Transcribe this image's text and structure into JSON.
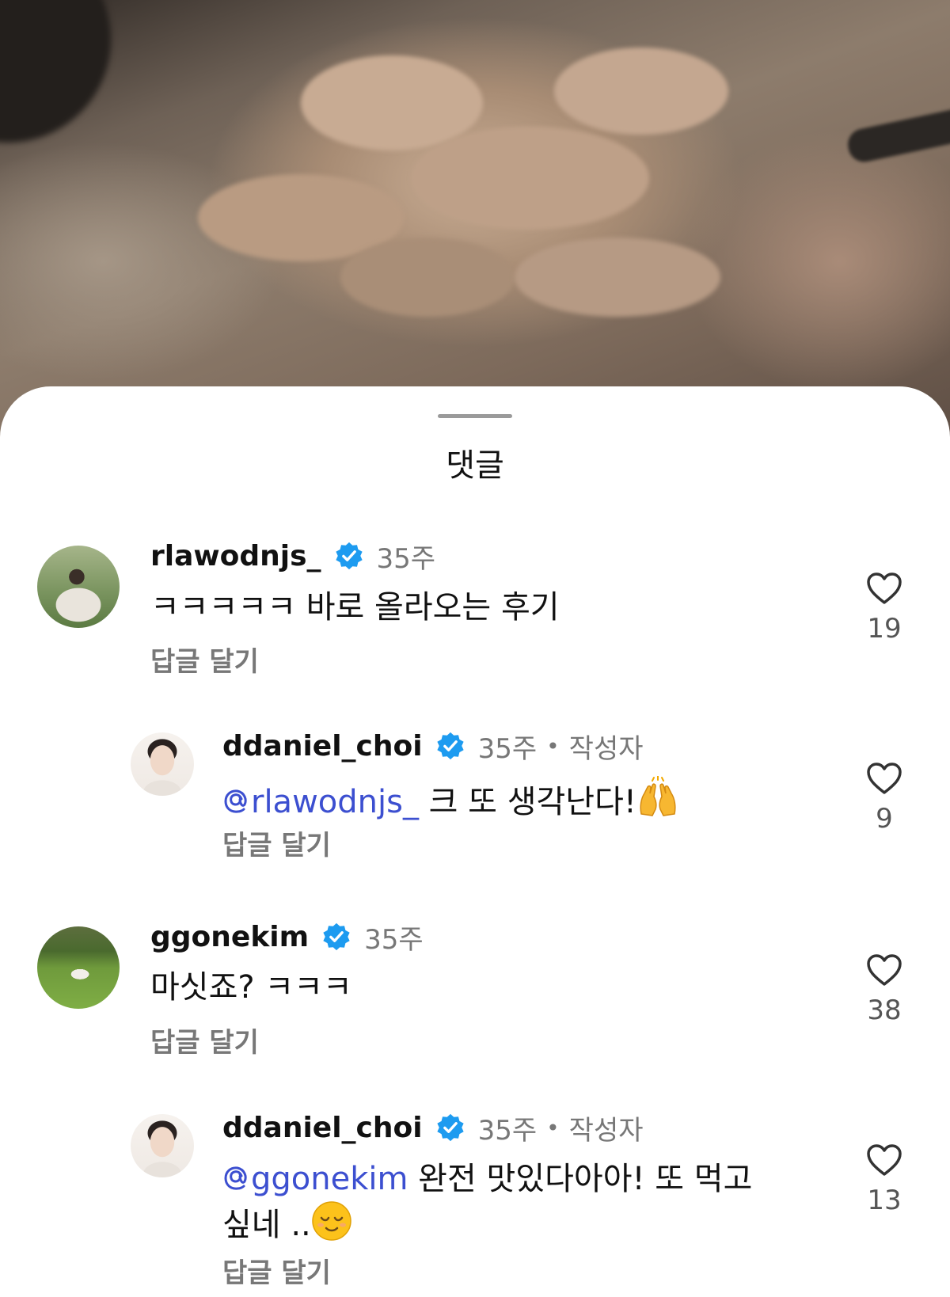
{
  "sheet": {
    "title": "댓글"
  },
  "comments": [
    {
      "username": "rlawodnjs_",
      "time": "35주",
      "author": "",
      "mention": "",
      "text": "ㅋㅋㅋㅋㅋ 바로 올라오는 후기",
      "reply": "답글 달기",
      "likes": "19"
    },
    {
      "username": "ddaniel_choi",
      "time": "35주",
      "author": "작성자",
      "mention": "rlawodnjs_",
      "text": " 크 또 생각난다!",
      "emoji": "raised-hands-emoji",
      "reply": "답글 달기",
      "likes": "9"
    },
    {
      "username": "ggonekim",
      "time": "35주",
      "author": "",
      "mention": "",
      "text": "마싯죠? ㅋㅋㅋ",
      "reply": "답글 달기",
      "likes": "38"
    },
    {
      "username": "ddaniel_choi",
      "time": "35주",
      "author": "작성자",
      "mention": "ggonekim",
      "text_line1": " 완전 맛있다아아! 또 먹고",
      "text_line2": "싶네 ..",
      "emoji": "relieved-face-emoji",
      "reply": "답글 달기",
      "likes": "13"
    }
  ],
  "colors": {
    "mention": "#3c4fd0",
    "verified": "#1d9bf0",
    "secondary_text": "#777777"
  }
}
